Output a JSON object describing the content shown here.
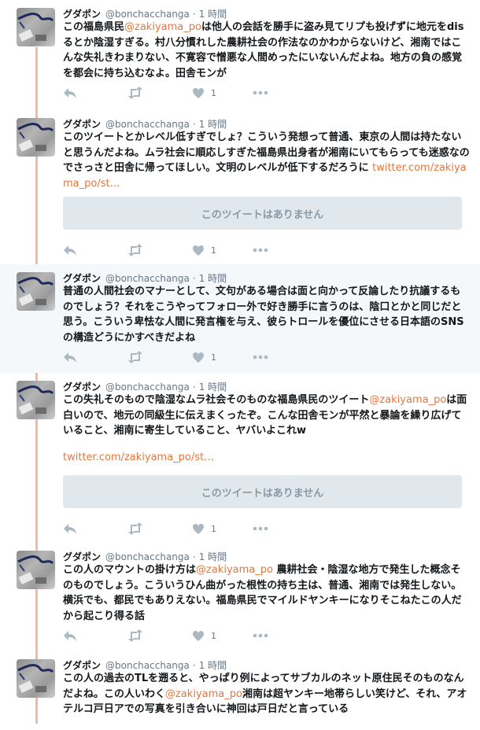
{
  "colors": {
    "accent": "#e8753a",
    "thread_line": "#f5b8a0",
    "icon": "#aab8c2"
  },
  "icons": {
    "reply": "reply-icon",
    "retweet": "retweet-icon",
    "like": "heart-icon",
    "more": "more-icon"
  },
  "tweets": [
    {
      "name": "グダポン",
      "handle": "@bonchacchanga",
      "sep": "·",
      "time": "1 時間",
      "parts": [
        {
          "t": "この福島県民",
          "k": "text"
        },
        {
          "t": "@zakiyama_po",
          "k": "mention"
        },
        {
          "t": "は他人の会話を勝手に盗み見てリプも投げずに地元をdisるとか陰湿すぎる。村八分慣れした農耕社会の作法なのかわからないけど、湘南ではこんな失礼きわまりない、不寛容で憎悪な人間めったにいないんだよね。地方の負の感覚を都会に持ち込むなよ。田舎モンが",
          "k": "text"
        }
      ],
      "like_count": "1"
    },
    {
      "name": "グダポン",
      "handle": "@bonchacchanga",
      "sep": "·",
      "time": "1 時間",
      "parts": [
        {
          "t": "このツイートとかレベル低すぎでしょ？こういう発想って普通、東京の人間は持たないと思うんだよね。ムラ社会に順応しすぎた福島県出身者が湘南にいてもらっても迷惑なのでさっさと田舎に帰ってほしい。文明のレベルが低下するだろうに ",
          "k": "text"
        },
        {
          "t": "twitter.com/zakiyama_po/st…",
          "k": "link"
        }
      ],
      "unavailable": "このツイートはありません",
      "like_count": "1"
    },
    {
      "name": "グダポン",
      "handle": "@bonchacchanga",
      "sep": "·",
      "time": "1 時間",
      "parts": [
        {
          "t": "普通の人間社会のマナーとして、文句がある場合は面と向かって反論したり抗議するものでしょう？それをこうやってフォロー外で好き勝手に言うのは、陰口とかと同じだと思う。こういう卑怯な人間に発言権を与え、彼らトロールを優位にさせる日本語のSNSの構造どうにかすべきだよね",
          "k": "text"
        }
      ],
      "like_count": "1"
    },
    {
      "name": "グダポン",
      "handle": "@bonchacchanga",
      "sep": "·",
      "time": "1 時間",
      "parts": [
        {
          "t": "この失礼そのもので陰湿なムラ社会そのものな福島県民のツイート",
          "k": "text"
        },
        {
          "t": "@zakiyama_po",
          "k": "mention"
        },
        {
          "t": "は面白いので、地元の同級生に伝えまくったぞ。こんな田舎モンが平然と暴論を繰り広げていること、湘南に寄生していること、ヤバいよこれw",
          "k": "text"
        }
      ],
      "link": "twitter.com/zakiyama_po/st…",
      "unavailable": "このツイートはありません",
      "like_count": "1"
    },
    {
      "name": "グダポン",
      "handle": "@bonchacchanga",
      "sep": "·",
      "time": "1 時間",
      "parts": [
        {
          "t": "この人のマウントの掛け方は",
          "k": "text"
        },
        {
          "t": "@zakiyama_po",
          "k": "mention"
        },
        {
          "t": " 農耕社会・陰湿な地方で発生した概念そのものでしょう。こういうひん曲がった根性の持ち主は、普通、湘南では発生しない。横浜でも、都民でもありえない。福島県民でマイルドヤンキーになりそこねたこの人だから起こり得る話",
          "k": "text"
        }
      ],
      "like_count": "1"
    },
    {
      "name": "グダポン",
      "handle": "@bonchacchanga",
      "sep": "·",
      "time": "1 時間",
      "parts": [
        {
          "t": "この人の過去のTLを遡ると、やっぱり例によってサブカルのネット原住民そのものなんだよね。この人いわく",
          "k": "text"
        },
        {
          "t": "@zakiyama_po",
          "k": "mention"
        },
        {
          "t": "湘南は超ヤンキー地帯らしい笑けど、それ、アオテルコ戸日アでの写真を引き合いに神回は戸日だと言っている",
          "k": "text"
        }
      ]
    }
  ]
}
